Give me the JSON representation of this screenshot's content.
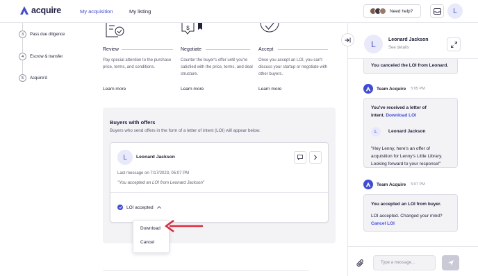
{
  "nav": {
    "brand": "acquire",
    "tabs": [
      {
        "label": "My acquisition",
        "active": true
      },
      {
        "label": "My listing",
        "active": false
      }
    ],
    "help_label": "Need help?",
    "user_initial": "L"
  },
  "steps": [
    {
      "num": "3",
      "label": "Pass due diligence"
    },
    {
      "num": "4",
      "label": "Escrow & transfer"
    },
    {
      "num": "5",
      "label": "Acquire'd"
    }
  ],
  "process": [
    {
      "title": "Review",
      "desc": "Pay special attention to the purchase price, terms, and conditions.",
      "link": "Learn more",
      "icon": "document-check-icon"
    },
    {
      "title": "Negotiate",
      "desc": "Counter the buyer's offer until you're satisfied with the price, terms, and deal structure.",
      "link": "Learn more",
      "icon": "chat-dollar-icon"
    },
    {
      "title": "Accept",
      "desc": "Once you accept an LOI, you can't discuss your startup or negotiate with other buyers.",
      "link": "Learn more",
      "icon": "check-circle-icon"
    }
  ],
  "buyers": {
    "title": "Buyers with offers",
    "subtitle": "Buyers who send offers in the form of a letter of intent (LOI) will appear below.",
    "card": {
      "initial": "L",
      "name": "Leonard Jackson",
      "meta": "Last message on 7/17/2023, 05:07 PM",
      "quote": "\"You accepted an LOI from Leonard Jackson\"",
      "status": "LOI accepted"
    },
    "dropdown": [
      "Download",
      "Cancel"
    ]
  },
  "chat": {
    "header": {
      "initial": "L",
      "name": "Leonard Jackson",
      "sub": "See details"
    },
    "msg0": "You canceled the LOI from Leonard.",
    "team_name": "Team Acquire",
    "time1": "5:05 PM",
    "msg1_line1": "You've received a letter of",
    "msg1_line2": "intent.",
    "msg1_link": "Download LOI",
    "msg1_sender_initial": "L",
    "msg1_sender": "Leonard Jackson",
    "msg1_quote_1": "\"Hey Lenny, here's an offer of",
    "msg1_quote_2": "acquisition for Lenny's Little Library.",
    "msg1_quote_3": "Looking forward to your response!\"",
    "time2": "5:07 PM",
    "msg2_title": "You accepted an LOI from buyer.",
    "msg2_text": "LOI accepted. Changed your mind?",
    "msg2_link": "Cancel LOI",
    "input_placeholder": "Type a message..."
  },
  "colors": {
    "accent": "#3d49e3",
    "arrow": "#e0283a"
  }
}
